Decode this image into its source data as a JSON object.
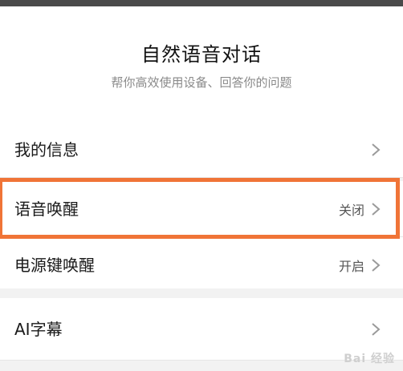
{
  "header": {
    "title": "自然语音对话",
    "subtitle": "帮你高效使用设备、回答你的问题"
  },
  "settings": [
    {
      "label": "我的信息",
      "value": ""
    },
    {
      "label": "语音唤醒",
      "value": "关闭"
    },
    {
      "label": "电源键唤醒",
      "value": "开启"
    },
    {
      "label": "AI字幕",
      "value": ""
    }
  ],
  "watermark": "Bai 经验",
  "colors": {
    "highlight": "#f07437",
    "background": "#f2f2f2",
    "row_background": "#ffffff"
  },
  "icons": {
    "row_arrow": "chevron-right-icon"
  }
}
